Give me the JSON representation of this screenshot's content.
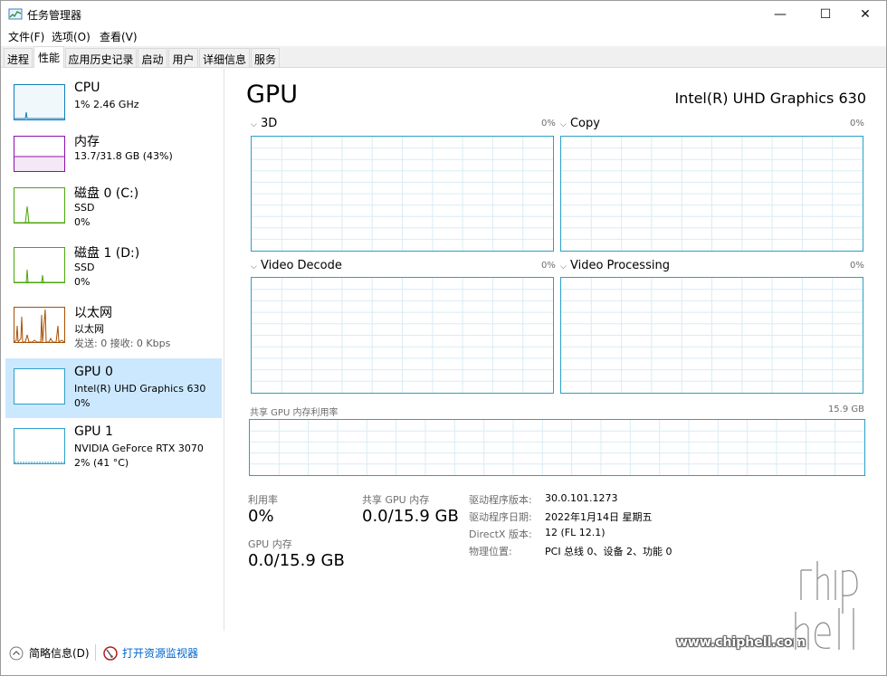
{
  "window": {
    "title": "任务管理器",
    "minimize_glyph": "—",
    "maximize_glyph": "☐",
    "close_glyph": "✕"
  },
  "menu": [
    {
      "label": "文件(F)"
    },
    {
      "label": "选项(O)"
    },
    {
      "label": "查看(V)"
    }
  ],
  "tabs": [
    {
      "label": "进程"
    },
    {
      "label": "性能"
    },
    {
      "label": "应用历史记录"
    },
    {
      "label": "启动"
    },
    {
      "label": "用户"
    },
    {
      "label": "详细信息"
    },
    {
      "label": "服务"
    }
  ],
  "active_tab": "性能",
  "sidebar": [
    {
      "title": "CPU",
      "line1": "1% 2.46 GHz",
      "line2": "",
      "line3": "",
      "color": "#117dbb"
    },
    {
      "title": "内存",
      "line1": "13.7/31.8 GB (43%)",
      "line2": "",
      "line3": "",
      "color": "#8b12ae"
    },
    {
      "title": "磁盘 0 (C:)",
      "line1": "SSD",
      "line2": "0%",
      "line3": "",
      "color": "#4da60c"
    },
    {
      "title": "磁盘 1 (D:)",
      "line1": "SSD",
      "line2": "0%",
      "line3": "",
      "color": "#4da60c"
    },
    {
      "title": "以太网",
      "line1": "以太网",
      "line2": "发送: 0 接收: 0 Kbps",
      "line3": "",
      "color": "#a74f01"
    },
    {
      "title": "GPU 0",
      "line1": "Intel(R) UHD Graphics 630",
      "line2": "0%",
      "line3": "",
      "color": "#2b9fc8"
    },
    {
      "title": "GPU 1",
      "line1": "NVIDIA GeForce RTX 3070",
      "line2": "2% (41 °C)",
      "line3": "",
      "color": "#2b9fc8"
    }
  ],
  "main": {
    "heading": "GPU",
    "gpu_name": "Intel(R) UHD Graphics 630",
    "engines": [
      {
        "label": "3D",
        "pct": "0%"
      },
      {
        "label": "Copy",
        "pct": "0%"
      },
      {
        "label": "Video Decode",
        "pct": "0%"
      },
      {
        "label": "Video Processing",
        "pct": "0%"
      }
    ],
    "shared_memory_label": "共享 GPU 内存利用率",
    "shared_memory_max": "15.9 GB",
    "stats": {
      "utilization_label": "利用率",
      "utilization_value": "0%",
      "shared_mem_label": "共享 GPU 内存",
      "shared_mem_value": "0.0/15.9 GB",
      "gpu_mem_label": "GPU 内存",
      "gpu_mem_value": "0.0/15.9 GB"
    },
    "info": [
      {
        "label": "驱动程序版本:",
        "value": "30.0.101.1273"
      },
      {
        "label": "驱动程序日期:",
        "value": "2022年1月14日 星期五"
      },
      {
        "label": "DirectX 版本:",
        "value": "12 (FL 12.1)"
      },
      {
        "label": "物理位置:",
        "value": "PCI 总线 0、设备 2、功能 0"
      }
    ]
  },
  "footer": {
    "summary_label": "简略信息(D)",
    "resmon_label": "打开资源监视器"
  },
  "watermark": {
    "url": "www.chiphell.com",
    "logo_text": "chip hell"
  },
  "accent_color": "#2b9fc8",
  "selection_color": "#cce8ff"
}
